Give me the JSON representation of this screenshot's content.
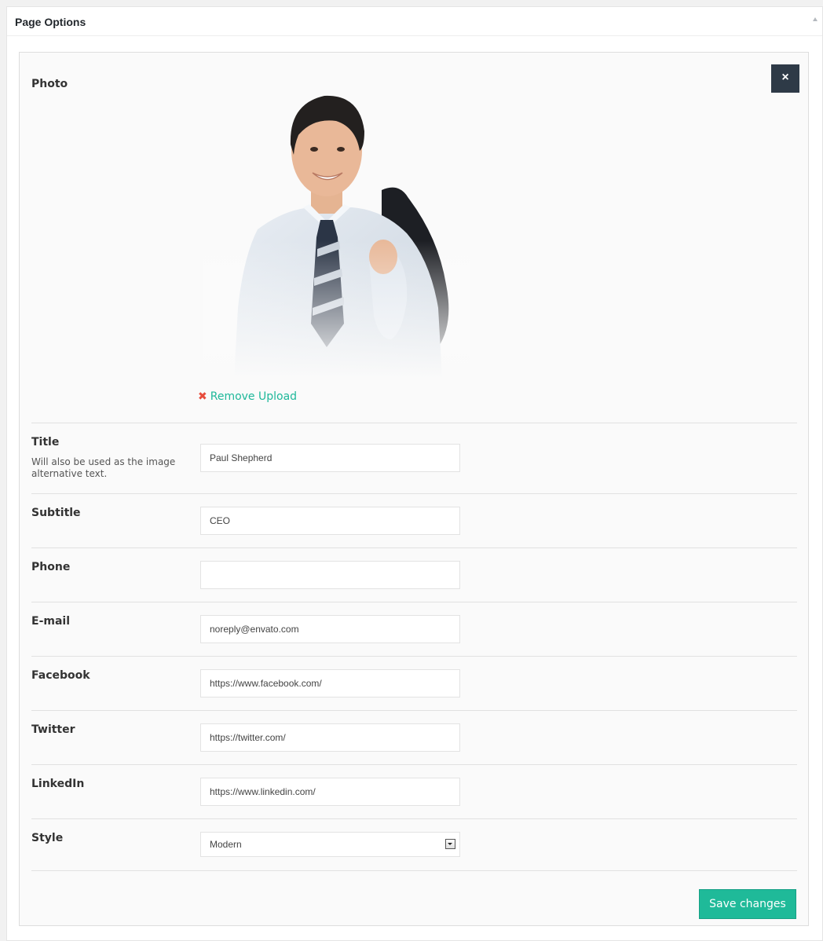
{
  "metabox": {
    "title": "Page Options"
  },
  "photo": {
    "label": "Photo",
    "remove_label": "Remove Upload"
  },
  "fields": {
    "title": {
      "label": "Title",
      "description": "Will also be used as the image alternative text.",
      "value": "Paul Shepherd"
    },
    "subtitle": {
      "label": "Subtitle",
      "value": "CEO"
    },
    "phone": {
      "label": "Phone",
      "value": ""
    },
    "email": {
      "label": "E-mail",
      "value": "noreply@envato.com"
    },
    "facebook": {
      "label": "Facebook",
      "value": "https://www.facebook.com/"
    },
    "twitter": {
      "label": "Twitter",
      "value": "https://twitter.com/"
    },
    "linkedin": {
      "label": "LinkedIn",
      "value": "https://www.linkedin.com/"
    },
    "style": {
      "label": "Style",
      "value": "Modern"
    }
  },
  "actions": {
    "close_label": "×",
    "save_label": "Save changes"
  },
  "colors": {
    "accent": "#1fba99",
    "remove_icon": "#e74c3c",
    "close_bg": "#2e3a47"
  }
}
